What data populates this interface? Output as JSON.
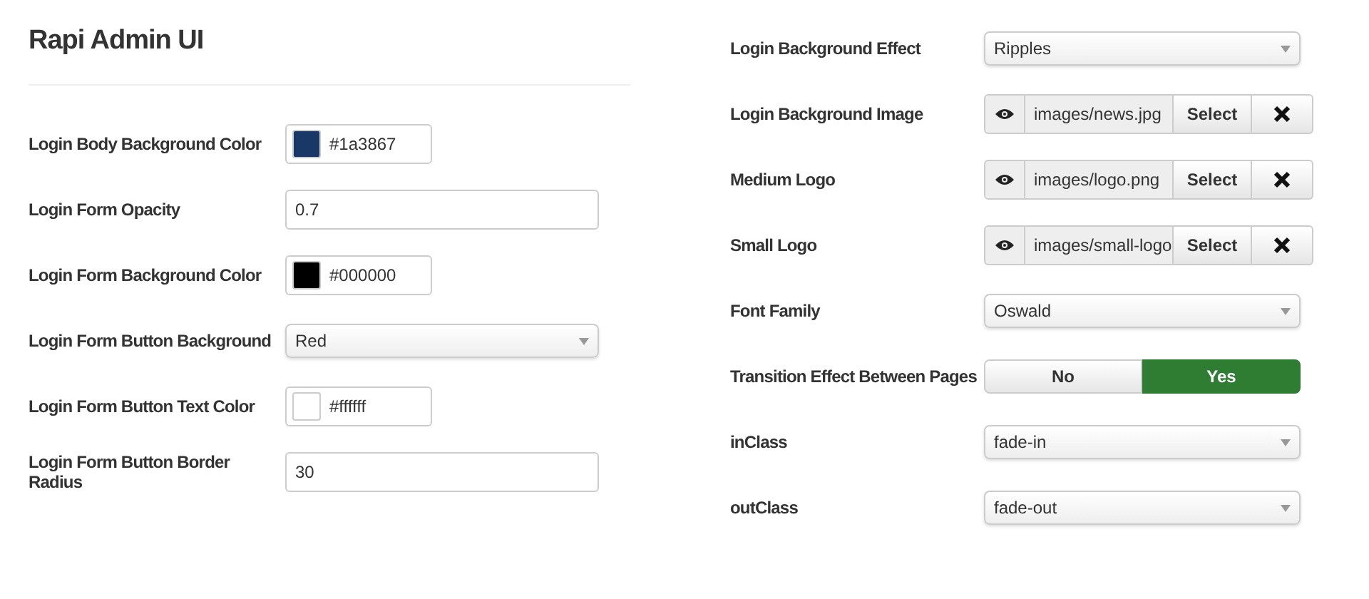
{
  "title": "Rapi Admin UI",
  "left_fields": [
    {
      "label": "Login Body Background Color",
      "kind": "color",
      "value": "#1a3867",
      "color": "#1a3867"
    },
    {
      "label": "Login Form Opacity",
      "kind": "text",
      "value": "0.7"
    },
    {
      "label": "Login Form Background Color",
      "kind": "color",
      "value": "#000000",
      "color": "#000000"
    },
    {
      "label": "Login Form Button Background",
      "kind": "select",
      "value": "Red"
    },
    {
      "label": "Login Form Button Text Color",
      "kind": "color",
      "value": "#ffffff",
      "color": "#ffffff"
    },
    {
      "label": "Login Form Button Border Radius",
      "kind": "text",
      "value": "30"
    }
  ],
  "right_fields": [
    {
      "label": "Login Background Effect",
      "kind": "select",
      "value": "Ripples"
    },
    {
      "label": "Login Background Image",
      "kind": "media",
      "value": "images/news.jpg",
      "button": "Select"
    },
    {
      "label": "Medium Logo",
      "kind": "media",
      "value": "images/logo.png",
      "button": "Select"
    },
    {
      "label": "Small Logo",
      "kind": "media",
      "value": "images/small-logo",
      "button": "Select"
    },
    {
      "label": "Font Family",
      "kind": "select",
      "value": "Oswald"
    },
    {
      "label": "Transition Effect Between Pages",
      "kind": "toggle",
      "options": [
        {
          "label": "No",
          "selected": false
        },
        {
          "label": "Yes",
          "selected": true
        }
      ]
    },
    {
      "label": "inClass",
      "kind": "select",
      "value": "fade-in"
    },
    {
      "label": "outClass",
      "kind": "select",
      "value": "fade-out"
    }
  ]
}
